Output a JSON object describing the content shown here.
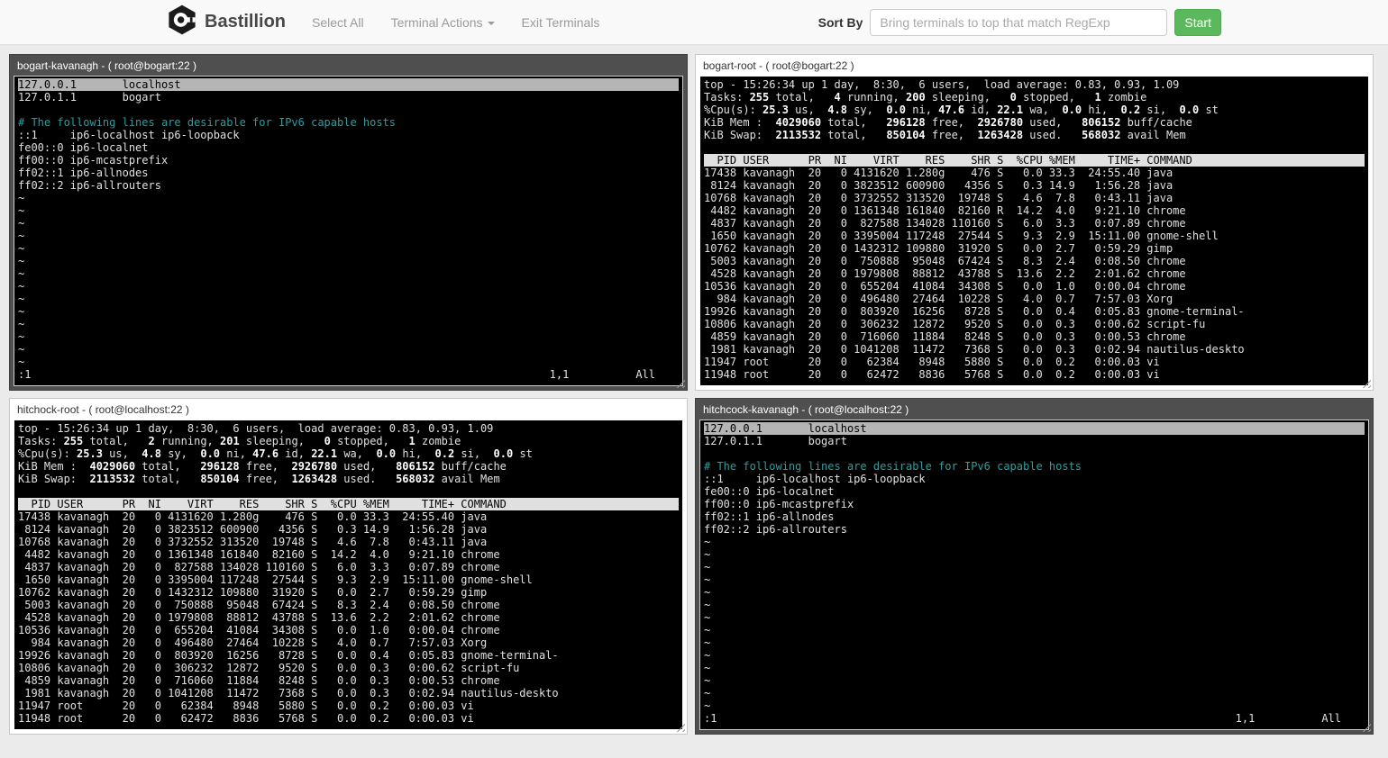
{
  "navbar": {
    "brand": "Bastillion",
    "items": [
      {
        "label": "Select All"
      },
      {
        "label": "Terminal Actions",
        "caret": true
      },
      {
        "label": "Exit Terminals"
      }
    ],
    "sort_by_label": "Sort By",
    "search_placeholder": "Bring terminals to top that match RegExp",
    "start_button": "Start"
  },
  "colors": {
    "accent_green": "#5cb85c",
    "navbar_bg": "#f9f9f9",
    "page_bg": "#ebebeb",
    "active_panel": "#4f4f4f",
    "inactive_panel": "#ffffff",
    "terminal_bg": "#000000",
    "terminal_fg": "#e0e0e0",
    "comment_cyan": "#26a0a0"
  },
  "terminals": [
    {
      "id": "bogart-kavanagh",
      "title": "bogart-kavanagh - ( root@bogart:22 )",
      "theme": "dark",
      "lines": [
        {
          "t": "127.0.0.1       localhost",
          "s": "cursor"
        },
        "127.0.1.1       bogart",
        "",
        {
          "t": "# The following lines are desirable for IPv6 capable hosts",
          "s": "comment"
        },
        "::1     ip6-localhost ip6-loopback",
        "fe00::0 ip6-localnet",
        "ff00::0 ip6-mcastprefix",
        "ff02::1 ip6-allnodes",
        "ff02::2 ip6-allrouters",
        "~",
        "~",
        "~",
        "~",
        "~",
        "~",
        "~",
        "~",
        "~",
        "~",
        "~",
        "~",
        "~",
        "~"
      ],
      "status": {
        "command": ":1",
        "ruler": "1,1",
        "position": "All"
      }
    },
    {
      "id": "bogart-root",
      "title": "bogart-root - ( root@bogart:22 )",
      "theme": "light",
      "lines": [
        "top - 15:26:34 up 1 day,  8:30,  6 users,  load average: 0.83, 0.93, 1.09",
        "Tasks: **255** total,   **4** running, **200** sleeping,   **0** stopped,   **1** zombie",
        "%Cpu(s): **25.3** us,  **4.8** sy,  **0.0** ni, **47.6** id, **22.1** wa,  **0.0** hi,  **0.2** si,  **0.0** st",
        "KiB Mem :  **4029060** total,   **296128** free,  **2926780** used,   **806152** buff/cache",
        "KiB Swap:  **2113532** total,   **850104** free,  **1263428** used.   **568032** avail Mem",
        "",
        {
          "t": "  PID USER      PR  NI    VIRT    RES    SHR S  %CPU %MEM     TIME+ COMMAND",
          "s": "header"
        },
        "17438 kavanagh  20   0 4131620 1.280g    476 S   0.0 33.3  24:55.40 java",
        " 8124 kavanagh  20   0 3823512 600900   4356 S   0.3 14.9   1:56.28 java",
        "10768 kavanagh  20   0 3732552 313520  19748 S   4.6  7.8   0:43.11 java",
        {
          "t": " 4482 kavanagh  20   0 1361348 161840  82160 R  14.2  4.0   9:21.10 chrome",
          "s": "bold"
        },
        " 4837 kavanagh  20   0  827588 134028 110160 S   6.0  3.3   0:07.89 chrome",
        " 1650 kavanagh  20   0 3395004 117248  27544 S   9.3  2.9  15:11.00 gnome-shell",
        "10762 kavanagh  20   0 1432312 109880  31920 S   0.0  2.7   0:59.29 gimp",
        " 5003 kavanagh  20   0  750888  95048  67424 S   8.3  2.4   0:08.50 chrome",
        " 4528 kavanagh  20   0 1979808  88812  43788 S  13.6  2.2   2:01.62 chrome",
        "10536 kavanagh  20   0  655204  41084  34308 S   0.0  1.0   0:00.04 chrome",
        "  984 kavanagh  20   0  496480  27464  10228 S   4.0  0.7   7:57.03 Xorg",
        "19926 kavanagh  20   0  803920  16256   8728 S   0.0  0.4   0:05.83 gnome-terminal-",
        "10806 kavanagh  20   0  306232  12872   9520 S   0.0  0.3   0:00.62 script-fu",
        " 4859 kavanagh  20   0  716060  11884   8248 S   0.0  0.3   0:00.53 chrome",
        " 1981 kavanagh  20   0 1041208  11472   7368 S   0.0  0.3   0:02.94 nautilus-deskto",
        "11947 root      20   0   62384   8948   5880 S   0.0  0.2   0:00.03 vi",
        "11948 root      20   0   62472   8836   5768 S   0.0  0.2   0:00.03 vi"
      ]
    },
    {
      "id": "hitchock-root",
      "title": "hitchock-root - ( root@localhost:22 )",
      "theme": "light",
      "lines": [
        "top - 15:26:34 up 1 day,  8:30,  6 users,  load average: 0.83, 0.93, 1.09",
        "Tasks: **255** total,   **2** running, **201** sleeping,   **0** stopped,   **1** zombie",
        "%Cpu(s): **25.3** us,  **4.8** sy,  **0.0** ni, **47.6** id, **22.1** wa,  **0.0** hi,  **0.2** si,  **0.0** st",
        "KiB Mem :  **4029060** total,   **296128** free,  **2926780** used,   **806152** buff/cache",
        "KiB Swap:  **2113532** total,   **850104** free,  **1263428** used.   **568032** avail Mem",
        "",
        {
          "t": "  PID USER      PR  NI    VIRT    RES    SHR S  %CPU %MEM     TIME+ COMMAND",
          "s": "header"
        },
        "17438 kavanagh  20   0 4131620 1.280g    476 S   0.0 33.3  24:55.40 java",
        " 8124 kavanagh  20   0 3823512 600900   4356 S   0.3 14.9   1:56.28 java",
        "10768 kavanagh  20   0 3732552 313520  19748 S   4.6  7.8   0:43.11 java",
        " 4482 kavanagh  20   0 1361348 161840  82160 S  14.2  4.0   9:21.10 chrome",
        " 4837 kavanagh  20   0  827588 134028 110160 S   6.0  3.3   0:07.89 chrome",
        " 1650 kavanagh  20   0 3395004 117248  27544 S   9.3  2.9  15:11.00 gnome-shell",
        "10762 kavanagh  20   0 1432312 109880  31920 S   0.0  2.7   0:59.29 gimp",
        " 5003 kavanagh  20   0  750888  95048  67424 S   8.3  2.4   0:08.50 chrome",
        " 4528 kavanagh  20   0 1979808  88812  43788 S  13.6  2.2   2:01.62 chrome",
        "10536 kavanagh  20   0  655204  41084  34308 S   0.0  1.0   0:00.04 chrome",
        "  984 kavanagh  20   0  496480  27464  10228 S   4.0  0.7   7:57.03 Xorg",
        "19926 kavanagh  20   0  803920  16256   8728 S   0.0  0.4   0:05.83 gnome-terminal-",
        "10806 kavanagh  20   0  306232  12872   9520 S   0.0  0.3   0:00.62 script-fu",
        " 4859 kavanagh  20   0  716060  11884   8248 S   0.0  0.3   0:00.53 chrome",
        " 1981 kavanagh  20   0 1041208  11472   7368 S   0.0  0.3   0:02.94 nautilus-deskto",
        "11947 root      20   0   62384   8948   5880 S   0.0  0.2   0:00.03 vi",
        "11948 root      20   0   62472   8836   5768 S   0.0  0.2   0:00.03 vi"
      ]
    },
    {
      "id": "hitchcock-kavanagh",
      "title": "hitchcock-kavanagh - ( root@localhost:22 )",
      "theme": "dark",
      "lines": [
        {
          "t": "127.0.0.1       localhost",
          "s": "cursor"
        },
        "127.0.1.1       bogart",
        "",
        {
          "t": "# The following lines are desirable for IPv6 capable hosts",
          "s": "comment"
        },
        "::1     ip6-localhost ip6-loopback",
        "fe00::0 ip6-localnet",
        "ff00::0 ip6-mcastprefix",
        "ff02::1 ip6-allnodes",
        "ff02::2 ip6-allrouters",
        "~",
        "~",
        "~",
        "~",
        "~",
        "~",
        "~",
        "~",
        "~",
        "~",
        "~",
        "~",
        "~",
        "~"
      ],
      "status": {
        "command": ":1",
        "ruler": "1,1",
        "position": "All"
      }
    }
  ]
}
